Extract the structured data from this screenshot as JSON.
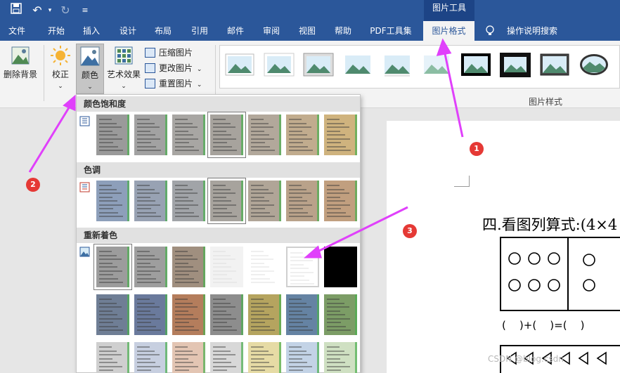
{
  "qat": {
    "save_icon": "save-icon",
    "undo_icon": "undo-icon",
    "redo_icon": "redo-icon",
    "customize_icon": "customize-qat-icon"
  },
  "context_tab_group": "图片工具",
  "tabs": [
    {
      "label": "文件"
    },
    {
      "label": "开始"
    },
    {
      "label": "插入"
    },
    {
      "label": "设计"
    },
    {
      "label": "布局"
    },
    {
      "label": "引用"
    },
    {
      "label": "邮件"
    },
    {
      "label": "审阅"
    },
    {
      "label": "视图"
    },
    {
      "label": "帮助"
    },
    {
      "label": "PDF工具集"
    },
    {
      "label": "图片格式"
    }
  ],
  "tell_me": "操作说明搜索",
  "ribbon": {
    "remove_bg": "删除背景",
    "corrections": "校正",
    "color": "颜色",
    "artistic": "艺术效果",
    "compress": "压缩图片",
    "change": "更改图片",
    "reset": "重置图片",
    "styles_group_label": "图片样式"
  },
  "dropdown": {
    "saturation_title": "颜色饱和度",
    "tone_title": "色调",
    "recolor_title": "重新着色"
  },
  "colors": {
    "saturation": [
      "#9a9a9a",
      "#a2a2a2",
      "#a8a6a3",
      "#a7a39d",
      "#b2a89b",
      "#c1ac8e",
      "#cfb37e"
    ],
    "tone": [
      "#8d9fba",
      "#98a2b3",
      "#a1a4a8",
      "#a7a39d",
      "#b0a597",
      "#b9a28a",
      "#c19f7f"
    ],
    "recolor_row1": [
      "#9c9c9c",
      "#9e9e9e",
      "#a08f7f",
      "#f2f2f2",
      "#ffffff",
      "#ffffff",
      "#000000"
    ],
    "recolor_row2": [
      "#6f7e95",
      "#6a7a9c",
      "#b47d5c",
      "#8d8d8d",
      "#b5a45f",
      "#6583a3",
      "#7c9d66"
    ],
    "recolor_row3": [
      "#cfcfcf",
      "#c7cfe0",
      "#e3c5b3",
      "#d8d8d8",
      "#e6dba5",
      "#c3d3e6",
      "#cfe0c2"
    ]
  },
  "annotations": [
    "1",
    "2",
    "3"
  ],
  "document": {
    "heading": "四.看图列算式:(4×4",
    "equation": "(    )+(    )=(    )"
  },
  "watermark": "CSDN @blog.csdn"
}
